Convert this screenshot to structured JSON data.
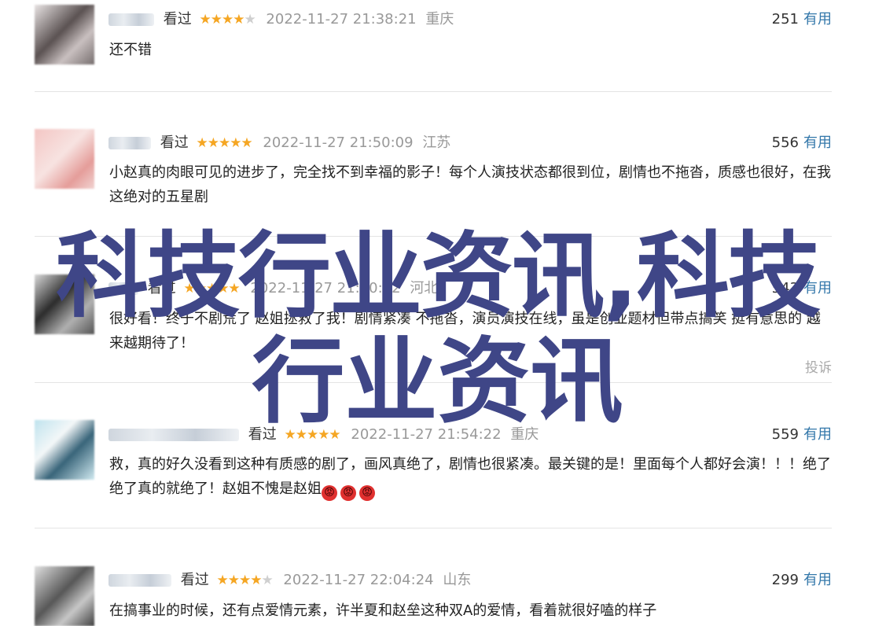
{
  "reviews": [
    {
      "watched": "看过",
      "rating": 4,
      "stars_on": "★★★★",
      "stars_off": "★",
      "time": "2022-11-27 21:38:21",
      "location": "重庆",
      "useful_count": "251",
      "useful_label": "有用",
      "content": "还不错"
    },
    {
      "watched": "看过",
      "rating": 5,
      "stars_on": "★★★★★",
      "stars_off": "",
      "time": "2022-11-27 21:50:09",
      "location": "江苏",
      "useful_count": "556",
      "useful_label": "有用",
      "content": "小赵真的肉眼可见的进步了，完全找不到幸福的影子！每个人演技状态都很到位，剧情也不拖沓，质感也很好，在我这绝对的五星剧"
    },
    {
      "watched": "看过",
      "rating": 5,
      "stars_on": "★★★★★",
      "stars_off": "",
      "time": "2022-11-27 21:50:52",
      "location": "河北",
      "useful_count": "543",
      "useful_label": "有用",
      "content": "很好看！终于不剧荒了 赵姐拯救了我！剧情紧凑 不拖沓，演员演技在线，虽是创业题材但带点搞笑 挺有意思的 越来越期待了！",
      "report_label": "投诉"
    },
    {
      "watched": "看过",
      "rating": 5,
      "stars_on": "★★★★★",
      "stars_off": "",
      "time": "2022-11-27 21:54:22",
      "location": "重庆",
      "useful_count": "559",
      "useful_label": "有用",
      "content": "救，真的好久没看到这种有质感的剧了，画风真绝了，剧情也很紧凑。最关键的是！里面每个人都好会演！！！绝了绝了真的就绝了！赵姐不愧是赵姐",
      "emoji": [
        "😡",
        "😡",
        "😡"
      ]
    },
    {
      "watched": "看过",
      "rating": 4,
      "stars_on": "★★★★",
      "stars_off": "★",
      "time": "2022-11-27 22:04:24",
      "location": "山东",
      "useful_count": "299",
      "useful_label": "有用",
      "content": "在搞事业的时候，还有点爱情元素，许半夏和赵垒这种双A的爱情，看着就很好嗑的样子"
    }
  ],
  "watermark": {
    "line1": "科技行业资讯,科技",
    "line2": "行业资讯"
  },
  "colors": {
    "star": "#f5a623",
    "useful_link": "#3377aa",
    "watermark": "#3f4687",
    "muted": "#999999"
  }
}
